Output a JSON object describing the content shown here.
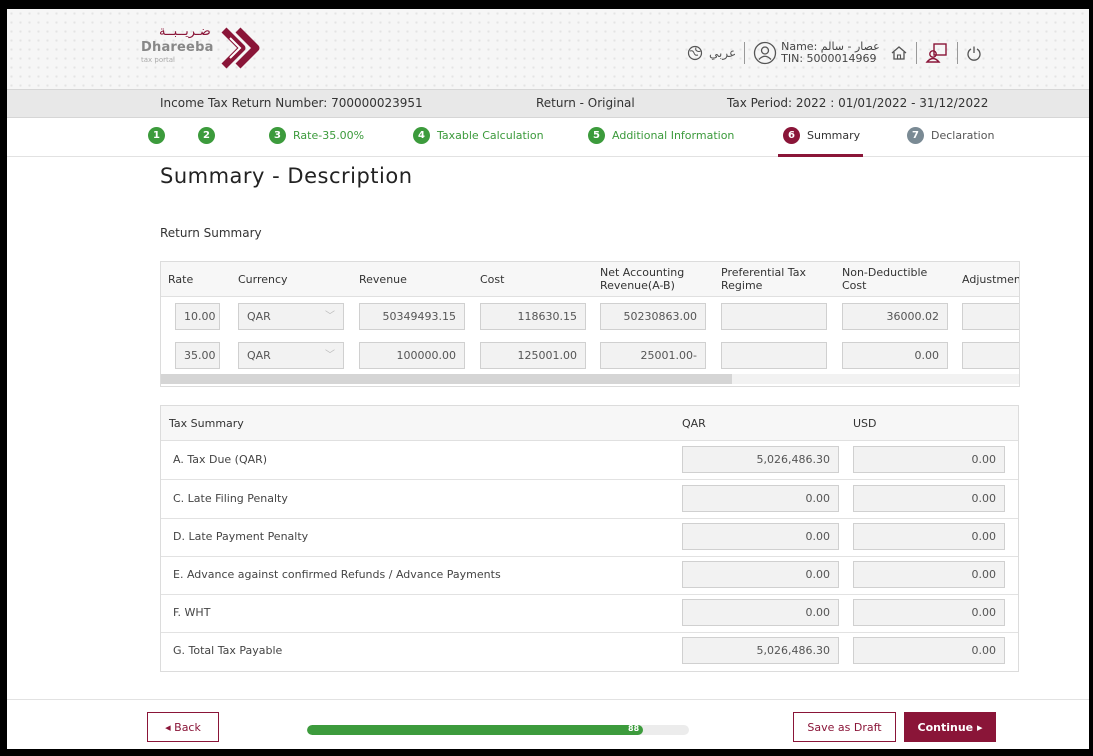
{
  "brand": {
    "logo_arabic": "ضـريــبــة",
    "logo_english": "Dhareeba",
    "logo_sub": "tax portal",
    "accent": "#8a1538",
    "success": "#3c9b3c"
  },
  "header": {
    "globe_icon": "globe-icon",
    "language": "عربي",
    "user_icon": "user-icon",
    "name_label": "Name: عصار - سالم",
    "tin_label": "TIN: 5000014969",
    "home_icon": "home-icon",
    "profile_switch_icon": "user-switch-icon",
    "power_icon": "power-icon"
  },
  "info_bar": {
    "return_number": "Income Tax Return Number: 700000023951",
    "return_type": "Return - Original",
    "tax_period": "Tax Period: 2022 : 01/01/2022 - 31/12/2022"
  },
  "steps": [
    {
      "num": "1",
      "label": "",
      "state": "done"
    },
    {
      "num": "2",
      "label": "",
      "state": "done"
    },
    {
      "num": "3",
      "label": "Rate-35.00%",
      "state": "done"
    },
    {
      "num": "4",
      "label": "Taxable Calculation",
      "state": "done"
    },
    {
      "num": "5",
      "label": "Additional Information",
      "state": "done"
    },
    {
      "num": "6",
      "label": "Summary",
      "state": "active"
    },
    {
      "num": "7",
      "label": "Declaration",
      "state": "pending"
    }
  ],
  "page_title": "Summary - Description",
  "return_summary": {
    "label": "Return Summary",
    "columns": [
      "Rate",
      "Currency",
      "Revenue",
      "Cost",
      "Net Accounting Revenue(A-B)",
      "Preferential Tax Regime",
      "Non-Deductible Cost",
      "Adjustmen"
    ],
    "rows": [
      {
        "rate": "10.00",
        "currency": "QAR",
        "revenue": "50349493.15",
        "cost": "118630.15",
        "net": "50230863.00",
        "preferential": "",
        "non_deductible": "36000.02",
        "adjustment": ""
      },
      {
        "rate": "35.00",
        "currency": "QAR",
        "revenue": "100000.00",
        "cost": "125001.00",
        "net": "25001.00-",
        "preferential": "",
        "non_deductible": "0.00",
        "adjustment": ""
      }
    ]
  },
  "tax_summary": {
    "header": "Tax Summary",
    "col_qar": "QAR",
    "col_usd": "USD",
    "rows": [
      {
        "label": "A. Tax Due (QAR)",
        "qar": "5,026,486.30",
        "usd": "0.00"
      },
      {
        "label": "C. Late Filing Penalty",
        "qar": "0.00",
        "usd": "0.00"
      },
      {
        "label": "D. Late Payment Penalty",
        "qar": "0.00",
        "usd": "0.00"
      },
      {
        "label": "E. Advance against confirmed Refunds / Advance Payments",
        "qar": "0.00",
        "usd": "0.00"
      },
      {
        "label": "F. WHT",
        "qar": "0.00",
        "usd": "0.00"
      },
      {
        "label": "G. Total Tax Payable",
        "qar": "5,026,486.30",
        "usd": "0.00"
      }
    ]
  },
  "footer": {
    "back_label": "◂ Back",
    "progress_value": 88,
    "progress_label": "88",
    "save_draft_label": "Save as Draft",
    "continue_label": "Continue ▸"
  }
}
